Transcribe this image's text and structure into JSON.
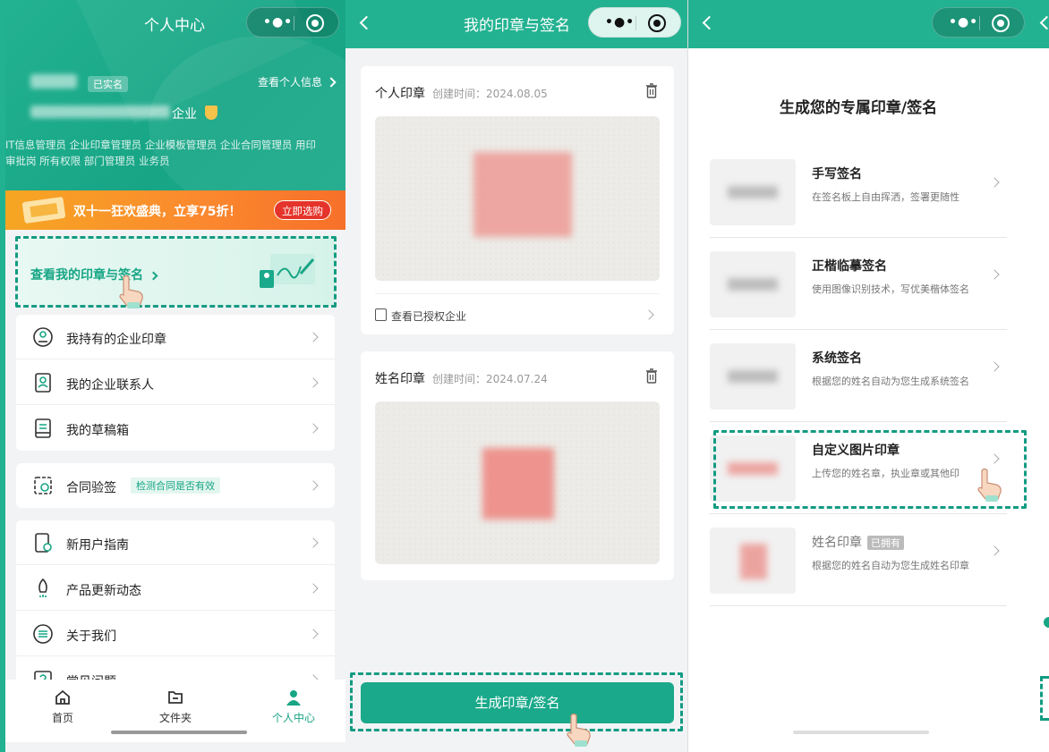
{
  "panel1": {
    "nav_title": "个人中心",
    "verified_badge": "已实名",
    "view_info": "查看个人信息",
    "company_suffix": "企业",
    "roles": "IT信息管理员 企业印章管理员 企业模板管理员 企业合同管理员 用印审批岗 所有权限 部门管理员 业务员",
    "promo_text": "双十一狂欢盛典，立享75折！",
    "promo_button": "立即选购",
    "seal_entry_label": "查看我的印章与签名",
    "menu_group1": [
      "我持有的企业印章",
      "我的企业联系人",
      "我的草稿箱"
    ],
    "contract_verify": {
      "label": "合同验签",
      "tag": "检测合同是否有效"
    },
    "menu_group3": [
      "新用户指南",
      "产品更新动态",
      "关于我们",
      "常见问题"
    ],
    "tabs": [
      "首页",
      "文件夹",
      "个人中心"
    ]
  },
  "panel2": {
    "nav_title": "我的印章与签名",
    "cards": [
      {
        "title": "个人印章",
        "time": "创建时间：2024.08.05",
        "auth": "查看已授权企业"
      },
      {
        "title": "姓名印章",
        "time": "创建时间：2024.07.24"
      }
    ],
    "generate_button": "生成印章/签名"
  },
  "panel3": {
    "heading": "生成您的专属印章/签名",
    "options": [
      {
        "title": "手写签名",
        "desc": "在签名板上自由挥洒，签署更随性"
      },
      {
        "title": "正楷临摹签名",
        "desc": "使用图像识别技术，写优美楷体签名"
      },
      {
        "title": "系统签名",
        "desc": "根据您的姓名自动为您生成系统签名"
      },
      {
        "title": "自定义图片印章",
        "desc": "上传您的姓名章，执业章或其他印"
      },
      {
        "title": "姓名印章",
        "badge": "已拥有",
        "desc": "根据您的姓名自动为您生成姓名印章"
      }
    ]
  },
  "colors": {
    "brand": "#23b291",
    "accent_dark": "#17a585",
    "promo": "#f7702a",
    "danger": "#e5342b"
  }
}
